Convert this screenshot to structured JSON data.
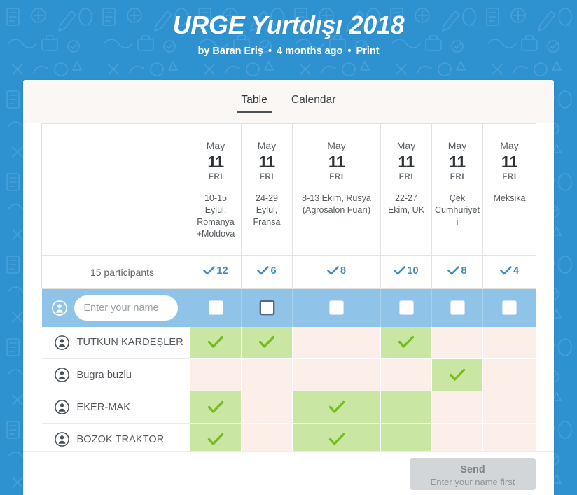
{
  "page": {
    "title": "URGE Yurtdışı 2018",
    "byline": {
      "author": "by Baran Eriş",
      "time": "4 months ago",
      "print": "Print",
      "separator": "•"
    },
    "background_color": "#2e92d1"
  },
  "card": {
    "tabs": [
      {
        "label": "Table",
        "active": true
      },
      {
        "label": "Calendar",
        "active": false
      }
    ]
  },
  "table": {
    "columns": [
      {
        "month": "May",
        "day": "11",
        "weekday": "FRI",
        "note": "10-15 Eylül, Romanya +Moldova",
        "count": "12"
      },
      {
        "month": "May",
        "day": "11",
        "weekday": "FRI",
        "note": "24-29 Eylül, Fransa",
        "count": "6"
      },
      {
        "month": "May",
        "day": "11",
        "weekday": "FRI",
        "note": "8-13 Ekim, Rusya (Agrosalon Fuarı)",
        "count": "8"
      },
      {
        "month": "May",
        "day": "11",
        "weekday": "FRI",
        "note": "22-27 Ekim, UK",
        "count": "10"
      },
      {
        "month": "May",
        "day": "11",
        "weekday": "FRI",
        "note": "Çek Cumhuriyeti",
        "count": "8"
      },
      {
        "month": "May",
        "day": "11",
        "weekday": "FRI",
        "note": "Meksika",
        "count": "4"
      }
    ],
    "participants_summary": "15 participants",
    "input_row": {
      "name_placeholder": "Enter your name",
      "name_value": "",
      "checkboxes": [
        {
          "checked": false,
          "focused": false
        },
        {
          "checked": false,
          "focused": true
        },
        {
          "checked": false,
          "focused": false
        },
        {
          "checked": false,
          "focused": false
        },
        {
          "checked": false,
          "focused": false
        },
        {
          "checked": false,
          "focused": false
        }
      ]
    },
    "rows": [
      {
        "name": "TUTKUN KARDEŞLER",
        "votes": [
          true,
          true,
          false,
          true,
          false,
          false
        ]
      },
      {
        "name": "Bugra buzlu",
        "votes": [
          false,
          false,
          false,
          false,
          true,
          false
        ]
      },
      {
        "name": "EKER-MAK",
        "votes": [
          true,
          false,
          true,
          true,
          false,
          false
        ]
      },
      {
        "name": "BOZOK TRAKTOR",
        "votes": [
          true,
          false,
          true,
          true,
          false,
          false
        ]
      }
    ]
  },
  "footer": {
    "send_label": "Send",
    "send_hint": "Enter your name first",
    "send_enabled": false
  },
  "colors": {
    "accent_blue": "#2e92d1",
    "yes_green": "#c9e7a2",
    "yes_check": "#76bc21",
    "no_pink": "#fceee9",
    "count_blue": "#3d8dbe",
    "highlight_row": "#8fc4e8"
  }
}
